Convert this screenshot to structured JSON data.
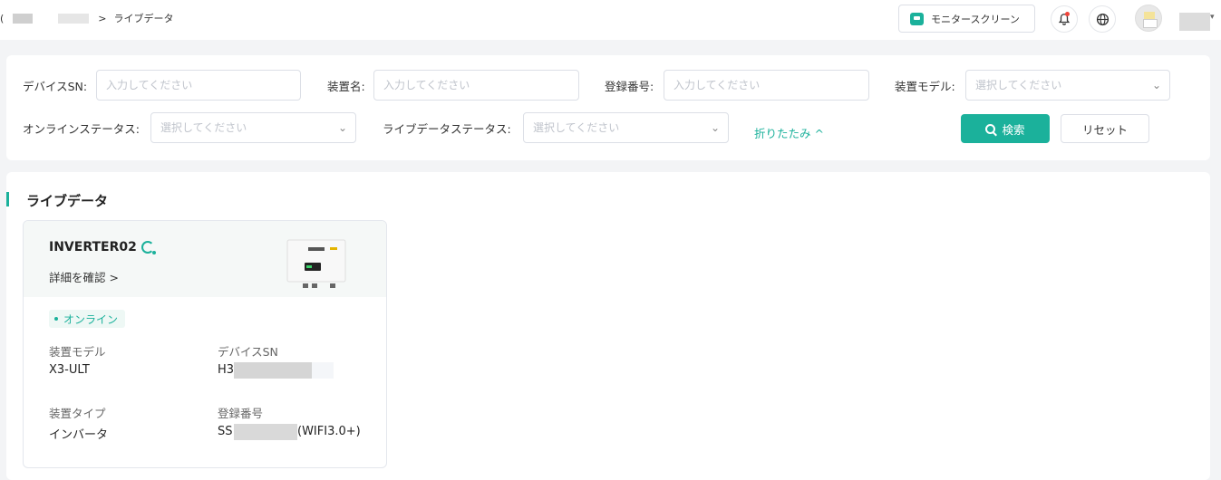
{
  "header": {
    "breadcrumb_prefix": "(",
    "breadcrumb_separator": ">",
    "breadcrumb_current": "ライブデータ",
    "monitor_button_label": "モニタースクリーン"
  },
  "filters": {
    "device_sn": {
      "label": "デバイスSN:",
      "placeholder": "入力してください"
    },
    "device_name": {
      "label": "装置名:",
      "placeholder": "入力してください"
    },
    "registration_no": {
      "label": "登録番号:",
      "placeholder": "入力してください"
    },
    "device_model": {
      "label": "装置モデル:",
      "placeholder": "選択してください"
    },
    "online_status": {
      "label": "オンラインステータス:",
      "placeholder": "選択してください"
    },
    "live_data_status": {
      "label": "ライブデータステータス:",
      "placeholder": "選択してください"
    },
    "collapse_label": "折りたたみ ^",
    "search_label": "検索",
    "reset_label": "リセット"
  },
  "live_section": {
    "title": "ライブデータ",
    "card": {
      "device_name": "INVERTER02",
      "detail_link": "詳細を確認 >",
      "status": "オンライン",
      "fields": {
        "model_label": "装置モデル",
        "model_value": "X3-ULT",
        "sn_label": "デバイスSN",
        "sn_value": "H3",
        "type_label": "装置タイプ",
        "type_value": "インバータ",
        "reg_label": "登録番号",
        "reg_prefix": "SS",
        "reg_suffix": "(WIFI3.0+)"
      }
    }
  },
  "colors": {
    "accent": "#1bb19b",
    "notification": "#f0443a"
  }
}
